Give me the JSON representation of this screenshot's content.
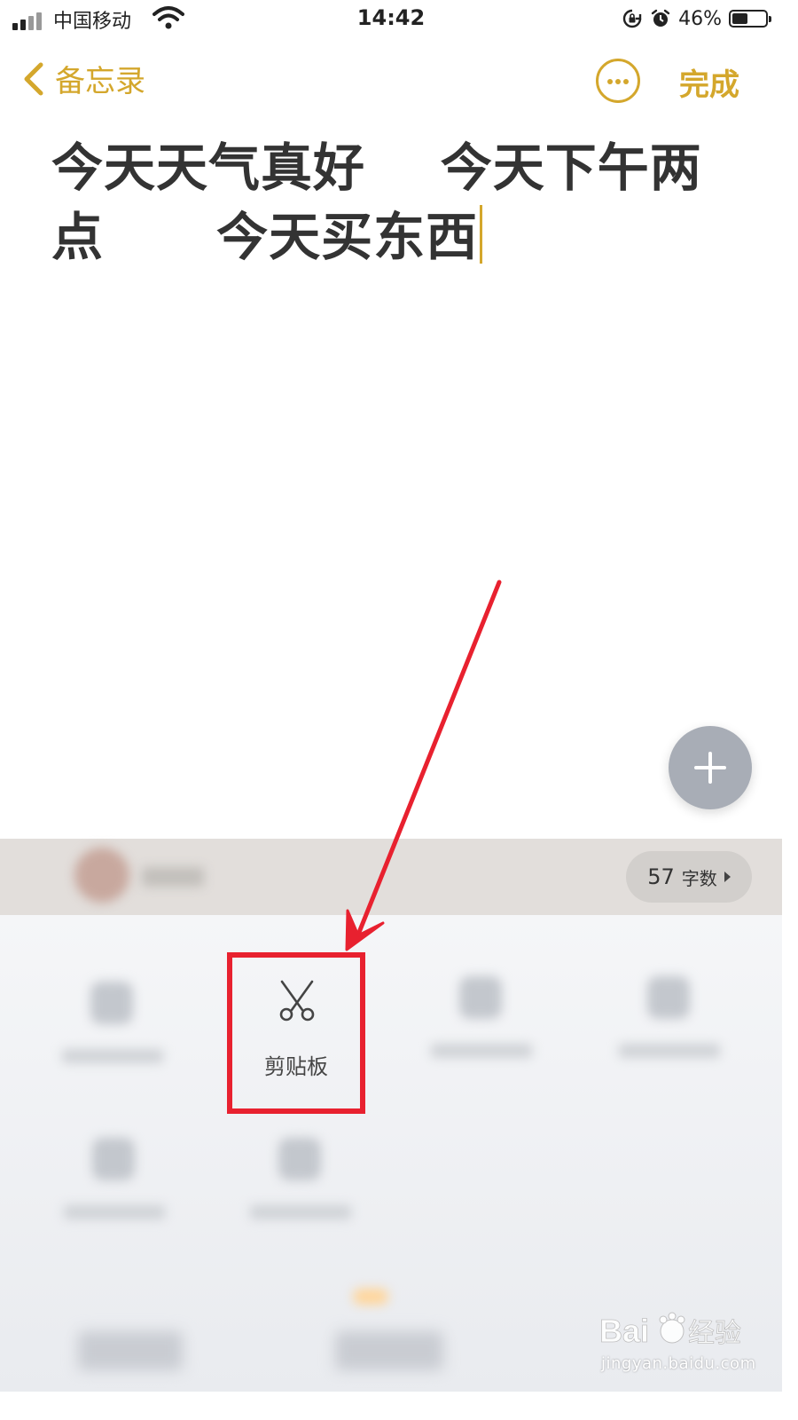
{
  "status_bar": {
    "carrier": "中国移动",
    "time": "14:42",
    "battery_text": "46%",
    "battery_level": 0.46,
    "icons": [
      "signal-icon",
      "wifi-icon",
      "rotation-lock-icon",
      "alarm-icon",
      "battery-icon"
    ]
  },
  "nav": {
    "back_label": "备忘录",
    "more_icon": "ellipsis-circle-icon",
    "done_label": "完成"
  },
  "note": {
    "line1": "今天天气真好    今天下午两",
    "line2": "点      今天买东西"
  },
  "info_bar": {
    "word_count": "57",
    "word_count_label": "字数"
  },
  "tools": {
    "clipboard_label": "剪贴板",
    "clipboard_icon": "scissors-icon"
  },
  "fab": {
    "icon": "plus-icon"
  },
  "watermark": {
    "url": "jingyan.baidu.com"
  },
  "colors": {
    "accent": "#d4a72c",
    "annotation_red": "#e8212f"
  }
}
